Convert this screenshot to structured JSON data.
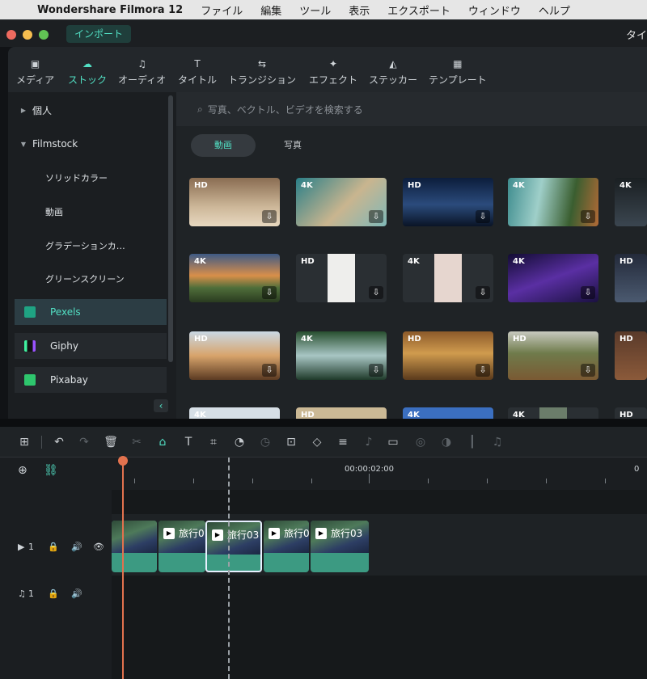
{
  "menubar": {
    "apple": "",
    "app": "Wondershare Filmora 12",
    "items": [
      "ファイル",
      "編集",
      "ツール",
      "表示",
      "エクスポート",
      "ウィンドウ",
      "ヘルプ"
    ]
  },
  "titlebar": {
    "import_label": "インポート",
    "title": "タイ"
  },
  "toolbar": {
    "items": [
      {
        "label": "メディア",
        "icon": "media-icon",
        "glyph": "▣"
      },
      {
        "label": "ストック",
        "icon": "stock-cloud-icon",
        "glyph": "☁"
      },
      {
        "label": "オーディオ",
        "icon": "music-note-icon",
        "glyph": "♫"
      },
      {
        "label": "タイトル",
        "icon": "title-text-icon",
        "glyph": "T"
      },
      {
        "label": "トランジション",
        "icon": "transition-arrows-icon",
        "glyph": "⇆"
      },
      {
        "label": "エフェクト",
        "icon": "effect-sparkle-icon",
        "glyph": "✦"
      },
      {
        "label": "ステッカー",
        "icon": "sticker-icon",
        "glyph": "◭"
      },
      {
        "label": "テンプレート",
        "icon": "template-grid-icon",
        "glyph": "▦"
      }
    ]
  },
  "sidebar": {
    "personal": "個人",
    "filmstock": "Filmstock",
    "filmstock_items": [
      "ソリッドカラー",
      "動画",
      "グラデーションカ…",
      "グリーンスクリーン"
    ],
    "sources": [
      "Pexels",
      "Giphy",
      "Pixabay"
    ],
    "collapse": "‹"
  },
  "content": {
    "search_placeholder": "写真、ベクトル、ビデオを検索する",
    "tabs": [
      "動画",
      "写真"
    ],
    "thumbs": [
      [
        "HD",
        "4K",
        "HD",
        "4K",
        "4K"
      ],
      [
        "4K",
        "HD",
        "4K",
        "4K",
        "HD"
      ],
      [
        "HD",
        "4K",
        "HD",
        "HD",
        "HD"
      ],
      [
        "4K",
        "HD",
        "4K",
        "4K",
        "HD"
      ]
    ],
    "download_glyph": "⇩"
  },
  "timeline": {
    "timecode": "00:00:02:00",
    "tracks": [
      {
        "label": "1",
        "type": "video"
      },
      {
        "label": "1",
        "type": "audio"
      }
    ],
    "clips": [
      "",
      "旅行0",
      "旅行03",
      "旅行0",
      "旅行03"
    ]
  },
  "colors": {
    "accent": "#52e0c4",
    "playhead": "#e2724e",
    "clip": "#3c9a82"
  }
}
